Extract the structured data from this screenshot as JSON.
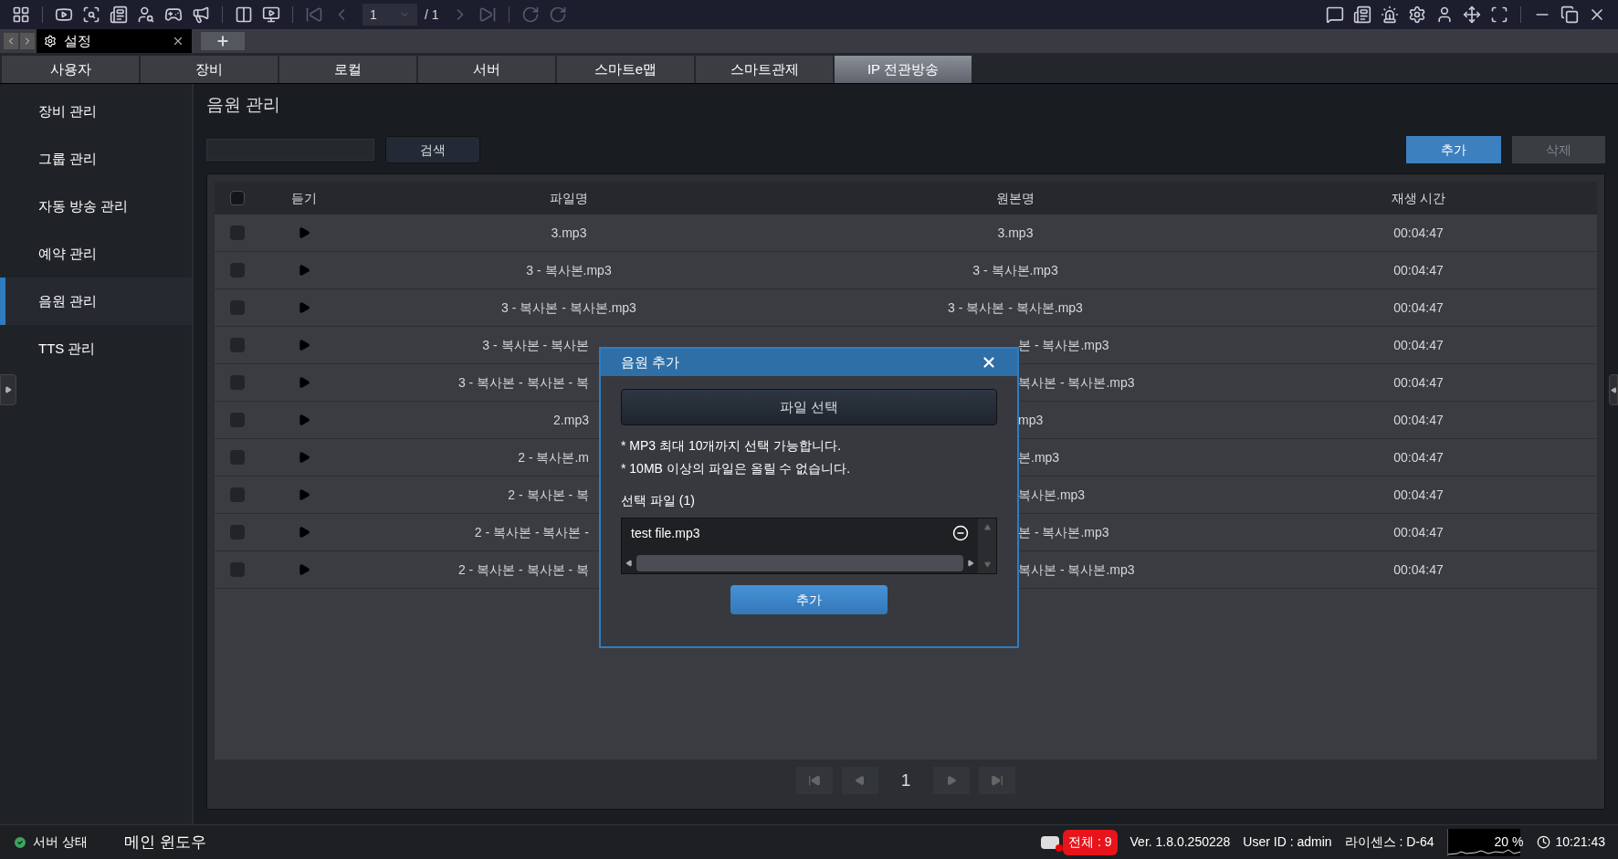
{
  "toolbar": {
    "page": "1",
    "page_total": "/ 1"
  },
  "doc_tab": {
    "label": "설정"
  },
  "menu_tabs": [
    {
      "label": "사용자",
      "selected": false
    },
    {
      "label": "장비",
      "selected": false
    },
    {
      "label": "로컬",
      "selected": false
    },
    {
      "label": "서버",
      "selected": false
    },
    {
      "label": "스마트e맵",
      "selected": false
    },
    {
      "label": "스마트관제",
      "selected": false
    },
    {
      "label": "IP 전관방송",
      "selected": true
    }
  ],
  "sidebar": {
    "items": [
      {
        "label": "장비 관리",
        "selected": false
      },
      {
        "label": "그룹 관리",
        "selected": false
      },
      {
        "label": "자동 방송 관리",
        "selected": false
      },
      {
        "label": "예약 관리",
        "selected": false
      },
      {
        "label": "음원 관리",
        "selected": true
      },
      {
        "label": "TTS 관리",
        "selected": false
      }
    ]
  },
  "content": {
    "title": "음원 관리",
    "search_button": "검색",
    "add_button": "추가",
    "delete_button": {
      "label": "삭제",
      "disabled": true
    }
  },
  "table": {
    "all_checked": false,
    "columns": [
      "듣기",
      "파일명",
      "원본명",
      "재생 시간"
    ],
    "rows": [
      {
        "checked": false,
        "covered": false,
        "file_name": "3.mp3",
        "original_name": "3.mp3",
        "duration": "00:04:47"
      },
      {
        "checked": false,
        "covered": false,
        "file_name": "3 - 복사본.mp3",
        "original_name": "3 - 복사본.mp3",
        "duration": "00:04:47"
      },
      {
        "checked": false,
        "covered": false,
        "file_name": "3 - 복사본 - 복사본.mp3",
        "original_name": "3 - 복사본 - 복사본.mp3",
        "duration": "00:04:47"
      },
      {
        "checked": false,
        "covered": true,
        "file_name": "3 - 복사본 - 복사본",
        "original_name": "본 - 복사본.mp3",
        "duration": "00:04:47"
      },
      {
        "checked": false,
        "covered": true,
        "file_name": "3 - 복사본 - 복사본 - 복",
        "original_name": "복사본 - 복사본.mp3",
        "duration": "00:04:47"
      },
      {
        "checked": false,
        "covered": true,
        "file_name": "2.mp3",
        "original_name": "mp3",
        "duration": "00:04:47"
      },
      {
        "checked": false,
        "covered": true,
        "file_name": "2 - 복사본.m",
        "original_name": "본.mp3",
        "duration": "00:04:47"
      },
      {
        "checked": false,
        "covered": true,
        "file_name": "2 - 복사본 - 복",
        "original_name": "복사본.mp3",
        "duration": "00:04:47"
      },
      {
        "checked": false,
        "covered": true,
        "file_name": "2 - 복사본 - 복사본 -",
        "original_name": "본 - 복사본.mp3",
        "duration": "00:04:47"
      },
      {
        "checked": false,
        "covered": true,
        "file_name": "2 - 복사본 - 복사본 - 복",
        "original_name": "복사본 - 복사본.mp3",
        "duration": "00:04:47"
      }
    ]
  },
  "pager": {
    "page": "1"
  },
  "dialog": {
    "title": "음원 추가",
    "file_button": "파일 선택",
    "notes": [
      "* MP3 최대 10개까지 선택 가능합니다.",
      "* 10MB 이상의 파일은 올릴 수 없습니다."
    ],
    "selected_label": "선택 파일 (1)",
    "files": [
      "test file.mp3"
    ],
    "add_button": "추가"
  },
  "status_bar": {
    "server": "서버 상태",
    "window": "메인 윈도우",
    "total": "전체 : 9",
    "version": "Ver. 1.8.0.250228",
    "user": "User ID : admin",
    "license": "라이센스 : D-64",
    "cpu": "20 %",
    "time": "10:21:43"
  }
}
